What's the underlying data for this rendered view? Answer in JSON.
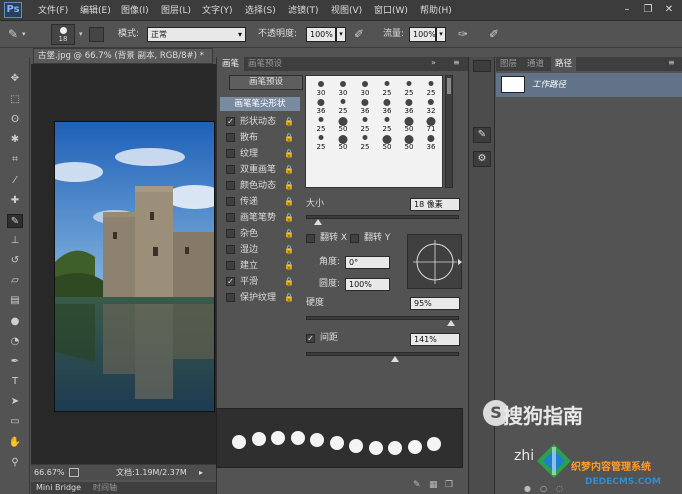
{
  "app": {
    "logo": "Ps"
  },
  "menu": [
    "文件(F)",
    "编辑(E)",
    "图像(I)",
    "图层(L)",
    "文字(Y)",
    "选择(S)",
    "滤镜(T)",
    "视图(V)",
    "窗口(W)",
    "帮助(H)"
  ],
  "window_controls": {
    "minimize": "–",
    "restore": "❐",
    "close": "✕"
  },
  "options_bar": {
    "brush_size": "18",
    "mode_label": "模式:",
    "mode_value": "正常",
    "opacity_label": "不透明度:",
    "opacity_value": "100%",
    "flow_label": "流量:",
    "flow_value": "100%"
  },
  "document": {
    "tab_title": "古堡.jpg @ 66.7% (背景 副本, RGB/8#) *",
    "zoom": "66.67%",
    "doc_info": "文档:1.19M/2.37M"
  },
  "bottom_tabs": [
    "Mini Bridge",
    "时间轴"
  ],
  "brush_panel": {
    "tabs": [
      "画笔",
      "画笔预设"
    ],
    "preset_button": "画笔预设",
    "tip_shape_header": "画笔笔尖形状",
    "options": [
      {
        "label": "形状动态",
        "checked": true
      },
      {
        "label": "散布",
        "checked": false
      },
      {
        "label": "纹理",
        "checked": false
      },
      {
        "label": "双重画笔",
        "checked": false
      },
      {
        "label": "颜色动态",
        "checked": false
      },
      {
        "label": "传递",
        "checked": false
      },
      {
        "label": "画笔笔势",
        "checked": false
      },
      {
        "label": "杂色",
        "checked": false
      },
      {
        "label": "湿边",
        "checked": false
      },
      {
        "label": "建立",
        "checked": false
      },
      {
        "label": "平滑",
        "checked": true
      },
      {
        "label": "保护纹理",
        "checked": false
      }
    ],
    "tip_sizes": [
      "30",
      "30",
      "30",
      "25",
      "25",
      "25",
      "36",
      "25",
      "36",
      "36",
      "36",
      "32",
      "25",
      "50",
      "25",
      "25",
      "50",
      "71",
      "25",
      "50",
      "25",
      "50",
      "50",
      "36"
    ],
    "size_label": "大小",
    "size_value": "18 像素",
    "flip_x_label": "翻转 X",
    "flip_y_label": "翻转 Y",
    "angle_label": "角度:",
    "angle_value": "0°",
    "roundness_label": "圆度:",
    "roundness_value": "100%",
    "hardness_label": "硬度",
    "hardness_value": "95%",
    "spacing_label": "间距",
    "spacing_value": "141%",
    "spacing_checked": true,
    "hardness_level": 0.95,
    "size_slider_level": 0.08,
    "spacing_slider_level": 0.58
  },
  "right_panel": {
    "tabs": [
      "图层",
      "通道",
      "路径"
    ],
    "active_tab": "路径",
    "path_name": "工作路径"
  },
  "watermarks": {
    "sogou": "搜狗指南",
    "zhi": "zhi",
    "cn": "织梦内容管理系统",
    "url": "DEDECMS.COM"
  },
  "colors": {
    "selection": "#627289",
    "panel_bg": "#535353",
    "menubar": "#3c3c3c"
  }
}
